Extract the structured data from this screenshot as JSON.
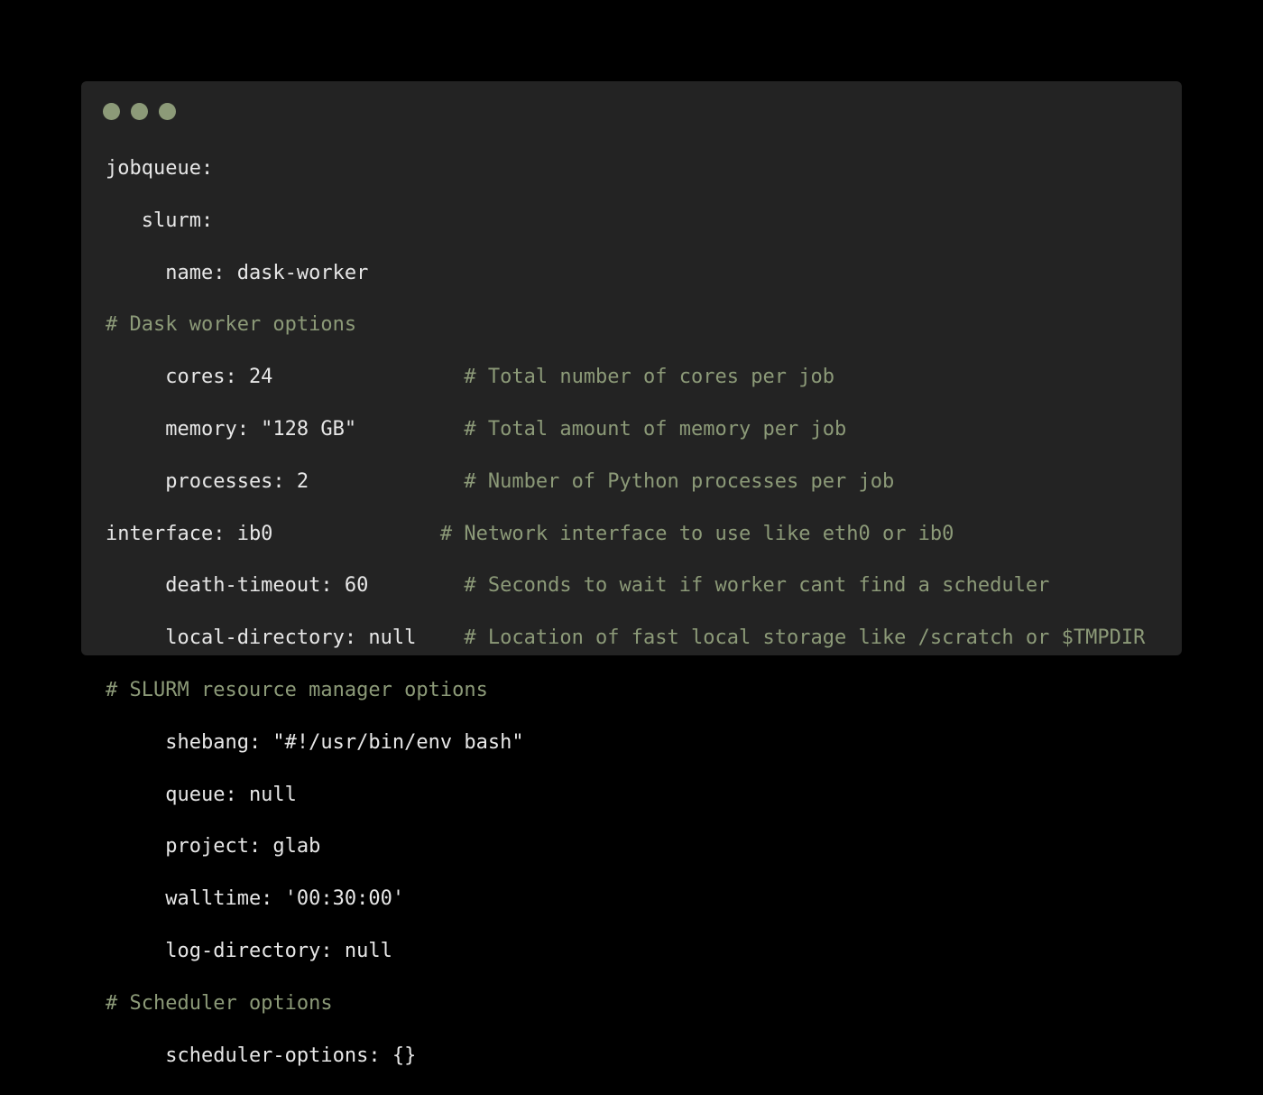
{
  "window": {
    "traffic_lights": [
      {
        "name": "close-dot",
        "color": "#8c9a78"
      },
      {
        "name": "minimize-dot",
        "color": "#8c9a78"
      },
      {
        "name": "maximize-dot",
        "color": "#8c9a78"
      }
    ]
  },
  "colors": {
    "background": "#000000",
    "window": "#232323",
    "code": "#e7e7e7",
    "comment": "#8c9a78"
  },
  "code_lines": [
    {
      "code": "jobqueue:",
      "comment": ""
    },
    {
      "code": "   slurm:",
      "comment": ""
    },
    {
      "code": "     name: dask-worker",
      "comment": ""
    },
    {
      "code": "",
      "comment": "# Dask worker options"
    },
    {
      "code": "     cores: 24                ",
      "comment": "# Total number of cores per job"
    },
    {
      "code": "     memory: \"128 GB\"         ",
      "comment": "# Total amount of memory per job"
    },
    {
      "code": "     processes: 2             ",
      "comment": "# Number of Python processes per job"
    },
    {
      "code": "interface: ib0              ",
      "comment": "# Network interface to use like eth0 or ib0"
    },
    {
      "code": "     death-timeout: 60        ",
      "comment": "# Seconds to wait if worker cant find a scheduler"
    },
    {
      "code": "     local-directory: null    ",
      "comment": "# Location of fast local storage like /scratch or $TMPDIR"
    },
    {
      "code": "",
      "comment": "# SLURM resource manager options"
    },
    {
      "code": "     shebang: \"#!/usr/bin/env bash\"",
      "comment": ""
    },
    {
      "code": "     queue: null",
      "comment": ""
    },
    {
      "code": "     project: glab",
      "comment": ""
    },
    {
      "code": "     walltime: '00:30:00'",
      "comment": ""
    },
    {
      "code": "     log-directory: null",
      "comment": ""
    },
    {
      "code": "",
      "comment": "# Scheduler options"
    },
    {
      "code": "     scheduler-options: {}",
      "comment": ""
    }
  ]
}
